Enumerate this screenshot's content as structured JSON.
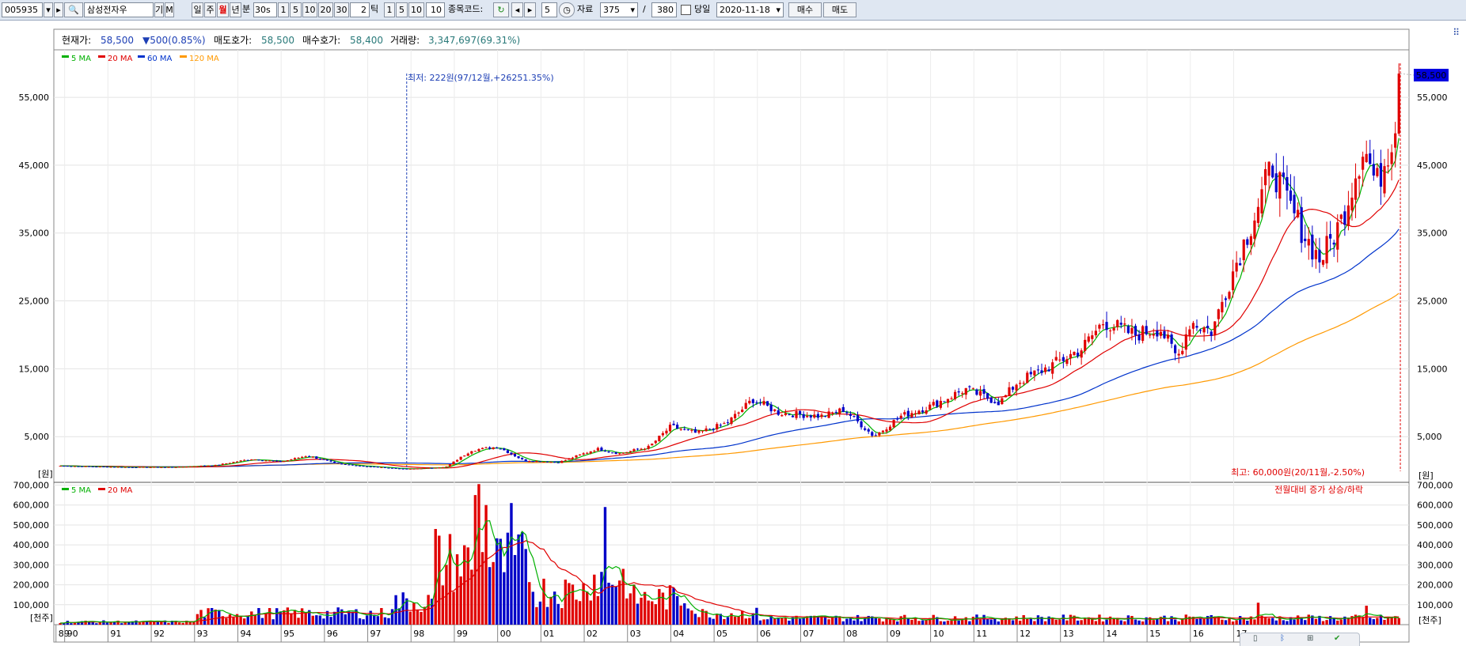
{
  "toolbar": {
    "code": "005935",
    "name": "삼성전자우",
    "mode_labels": [
      "일",
      "주",
      "월",
      "년",
      "분"
    ],
    "active_mode": "월",
    "interval_value": "30s",
    "minute_options": [
      "1",
      "5",
      "10",
      "20",
      "30"
    ],
    "tick_value": "2",
    "tick_label": "틱",
    "tick_options": [
      "1",
      "5",
      "10"
    ],
    "tick_custom": "10",
    "stock_code_label": "종목코드:",
    "step_value": "5",
    "data_label": "자료",
    "data_count": "375",
    "slash": "/",
    "data_total": "380",
    "same_day_label": "당일",
    "date_value": "2020-11-18",
    "buy_label": "매수",
    "sell_label": "매도",
    "small_buttons": [
      "기",
      "M"
    ]
  },
  "info_bar": {
    "price_label": "현재가:",
    "price": "58,500",
    "change": "▼500(0.85%)",
    "ask_label": "매도호가:",
    "ask": "58,500",
    "bid_label": "매수호가:",
    "bid": "58,400",
    "volume_label": "거래량:",
    "volume": "3,347,697(69.31%)"
  },
  "price_chart": {
    "legend": [
      {
        "label": "5 MA",
        "color": "#00b000"
      },
      {
        "label": "20 MA",
        "color": "#e00000"
      },
      {
        "label": "60 MA",
        "color": "#0033cc"
      },
      {
        "label": "120 MA",
        "color": "#ff9900"
      }
    ],
    "y_ticks": [
      "55,000",
      "45,000",
      "35,000",
      "25,000",
      "15,000",
      "5,000"
    ],
    "y_unit": "[원]",
    "current_price_tag": "58,500",
    "low_annotation": "최저: 222원(97/12월,+26251.35%)",
    "high_annotation": "최고: 60,000원(20/11월,-2.50%)"
  },
  "volume_chart": {
    "legend": [
      {
        "label": "5 MA",
        "color": "#00b000"
      },
      {
        "label": "20 MA",
        "color": "#e00000"
      }
    ],
    "y_ticks": [
      "700,000",
      "600,000",
      "500,000",
      "400,000",
      "300,000",
      "200,000",
      "100,000"
    ],
    "y_unit": "[천주]",
    "note": "전월대비 증가 상승/하락"
  },
  "x_axis": {
    "labels": [
      "89",
      "90",
      "91",
      "92",
      "93",
      "94",
      "95",
      "96",
      "97",
      "98",
      "99",
      "00",
      "01",
      "02",
      "03",
      "04",
      "05",
      "06",
      "07",
      "08",
      "09",
      "10",
      "11",
      "12",
      "13",
      "14",
      "15",
      "16",
      "17"
    ]
  },
  "colors": {
    "up": "#e00000",
    "down": "#0000c8",
    "background": "#ffffff",
    "toolbar": "#dfe7f2"
  },
  "chart_data": {
    "type": "candlestick",
    "frequency": "monthly",
    "price_unit": "원",
    "volume_unit": "천주",
    "ylim_price": [
      -1500,
      62000
    ],
    "ylim_volume": [
      0,
      710000
    ],
    "keys": [
      {
        "year": 1989.9,
        "close": 700
      },
      {
        "year": 1990.5,
        "close": 600
      },
      {
        "year": 1991.5,
        "close": 500
      },
      {
        "year": 1992.5,
        "close": 500
      },
      {
        "year": 1993.5,
        "close": 800
      },
      {
        "year": 1994.3,
        "close": 1700
      },
      {
        "year": 1995.0,
        "close": 1300
      },
      {
        "year": 1995.6,
        "close": 2200
      },
      {
        "year": 1996.3,
        "close": 1000
      },
      {
        "year": 1997.0,
        "close": 600
      },
      {
        "year": 1997.9,
        "close": 222
      },
      {
        "year": 1998.8,
        "close": 500
      },
      {
        "year": 1999.4,
        "close": 3000
      },
      {
        "year": 2000.0,
        "close": 3500
      },
      {
        "year": 2000.6,
        "close": 1500
      },
      {
        "year": 2001.4,
        "close": 1200
      },
      {
        "year": 2002.3,
        "close": 3200
      },
      {
        "year": 2002.8,
        "close": 2500
      },
      {
        "year": 2003.5,
        "close": 3500
      },
      {
        "year": 2004.0,
        "close": 6500
      },
      {
        "year": 2004.6,
        "close": 5500
      },
      {
        "year": 2005.3,
        "close": 7000
      },
      {
        "year": 2005.9,
        "close": 10500
      },
      {
        "year": 2006.5,
        "close": 8500
      },
      {
        "year": 2007.5,
        "close": 8000
      },
      {
        "year": 2008.0,
        "close": 9000
      },
      {
        "year": 2008.7,
        "close": 5000
      },
      {
        "year": 2009.3,
        "close": 8000
      },
      {
        "year": 2010.0,
        "close": 9500
      },
      {
        "year": 2010.8,
        "close": 12000
      },
      {
        "year": 2011.6,
        "close": 10000
      },
      {
        "year": 2012.0,
        "close": 13000
      },
      {
        "year": 2012.8,
        "close": 15500
      },
      {
        "year": 2013.5,
        "close": 18000
      },
      {
        "year": 2014.0,
        "close": 22000
      },
      {
        "year": 2014.7,
        "close": 20000
      },
      {
        "year": 2015.3,
        "close": 21000
      },
      {
        "year": 2015.7,
        "close": 16500
      },
      {
        "year": 2016.0,
        "close": 22000
      },
      {
        "year": 2016.5,
        "close": 20500
      },
      {
        "year": 2016.9,
        "close": 28000
      },
      {
        "year": 2017.5,
        "close": 38000
      },
      {
        "year": 2017.9,
        "close": 45000
      },
      {
        "year": 2018.2,
        "close": 40000
      },
      {
        "year": 2018.7,
        "close": 34000
      },
      {
        "year": 2019.0,
        "close": 31000
      },
      {
        "year": 2019.5,
        "close": 37000
      },
      {
        "year": 2020.0,
        "close": 48000
      },
      {
        "year": 2020.3,
        "close": 42000
      },
      {
        "year": 2020.7,
        "close": 50000
      },
      {
        "year": 2020.85,
        "close": 58500
      }
    ],
    "low": {
      "year": 1997.9,
      "value": 222
    },
    "high": {
      "year": 2020.85,
      "value": 60000
    },
    "current": 58500
  }
}
